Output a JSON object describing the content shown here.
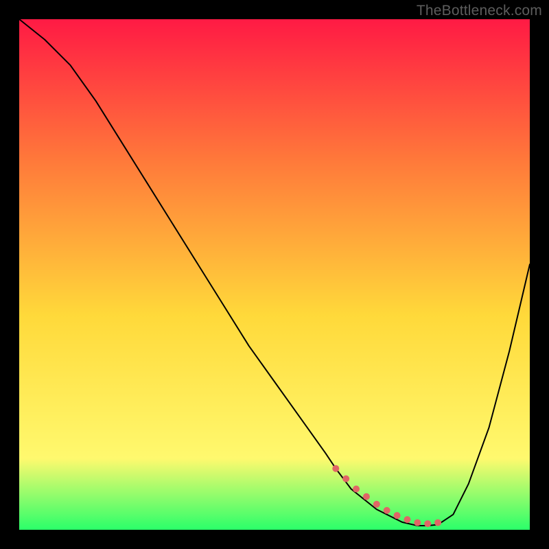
{
  "watermark": "TheBottleneck.com",
  "chart_data": {
    "type": "line",
    "title": "",
    "xlabel": "",
    "ylabel": "",
    "xlim": [
      0,
      100
    ],
    "ylim": [
      0,
      100
    ],
    "grid": false,
    "legend": false,
    "background_gradient": {
      "top": "#ff1a44",
      "upper_mid": "#ff7a3a",
      "mid": "#ffd93a",
      "lower_mid": "#fff96e",
      "bottom": "#2bff6a"
    },
    "series": [
      {
        "name": "curve",
        "color": "#000000",
        "stroke_width": 2,
        "x": [
          0,
          5,
          10,
          15,
          20,
          25,
          30,
          35,
          40,
          45,
          50,
          55,
          60,
          62,
          65,
          70,
          75,
          78,
          80,
          82,
          85,
          88,
          92,
          96,
          100
        ],
        "values": [
          100,
          96,
          91,
          84,
          76,
          68,
          60,
          52,
          44,
          36,
          29,
          22,
          15,
          12,
          8,
          4,
          1.5,
          0.8,
          0.8,
          1.0,
          3,
          9,
          20,
          35,
          52
        ]
      },
      {
        "name": "highlight-dots",
        "type": "scatter",
        "color": "#e06666",
        "marker_radius": 5,
        "x": [
          62,
          64,
          66,
          68,
          70,
          72,
          74,
          76,
          78,
          80,
          82
        ],
        "values": [
          12,
          10,
          8,
          6.5,
          5,
          3.8,
          2.8,
          2,
          1.4,
          1.2,
          1.4
        ]
      }
    ]
  }
}
